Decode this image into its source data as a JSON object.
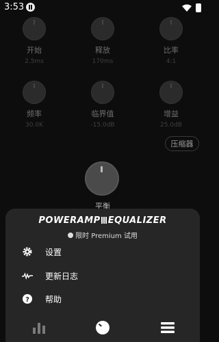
{
  "status_bar": {
    "time": "3:53"
  },
  "knobs": [
    {
      "label": "开始",
      "value": "2.5ms"
    },
    {
      "label": "释放",
      "value": "170ms"
    },
    {
      "label": "比率",
      "value": "4:1"
    },
    {
      "label": "频率",
      "value": "30.0K"
    },
    {
      "label": "临界值",
      "value": "-15.0dB"
    },
    {
      "label": "增益",
      "value": "25.0dB"
    }
  ],
  "compressor_button": "压缩器",
  "balance_label": "平衡",
  "sheet": {
    "brand_left": "POWERAMP",
    "brand_right": "EQUALIZER",
    "trial": "限时 Premium 试用",
    "menu": [
      {
        "label": "设置",
        "icon": "gear-icon"
      },
      {
        "label": "更新日志",
        "icon": "pulse-icon"
      },
      {
        "label": "帮助",
        "icon": "help-icon"
      }
    ]
  }
}
